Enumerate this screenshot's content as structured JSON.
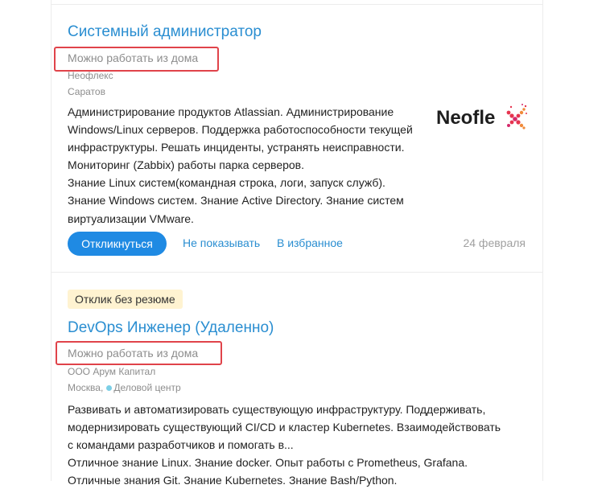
{
  "vacancies": [
    {
      "title": "Системный администратор",
      "remote": "Можно работать из дома",
      "company": "Неофлекс",
      "city": "Саратов",
      "description_lines": [
        "Администрирование продуктов Atlassian. Администрирование",
        "Windows/Linux серверов. Поддержка работоспособности текущей",
        "инфраструктуры. Решать инциденты, устранять неисправности.",
        "Мониторинг (Zabbix) работы парка серверов.",
        "Знание Linux систем(командная строка, логи, запуск служб).",
        "Знание Windows систем. Знание Active Directory. Знание систем",
        "виртуализации VMware."
      ],
      "logo_text": "Neofle",
      "actions": {
        "respond": "Откликнуться",
        "hide": "Не показывать",
        "favorite": "В избранное"
      },
      "date": "24 февраля"
    },
    {
      "badge": "Отклик без резюме",
      "title": "DevOps Инженер (Удаленно)",
      "remote": "Можно работать из дома",
      "company": "ООО Арум Капитал",
      "city": "Москва,",
      "metro": "Деловой центр",
      "description_lines": [
        "Развивать и автоматизировать существующую инфраструктуру. Поддерживать,",
        "модернизировать существующий CI/CD и кластер Kubernetes. Взаимодействовать",
        "с командами разработчиков и помогать в...",
        "Отличное знание Linux. Знание docker. Опыт работы с Prometheus, Grafana.",
        "Отличные знания Git. Знание Kubernetes. Знание Bash/Python."
      ]
    }
  ],
  "colors": {
    "link": "#2a8ed1",
    "button": "#1f8ae3",
    "highlight_box": "#e0434a",
    "badge_bg": "#fff3d1",
    "metro_dot": "#7ccfe6",
    "logo_x_accent": "#e6344f"
  }
}
